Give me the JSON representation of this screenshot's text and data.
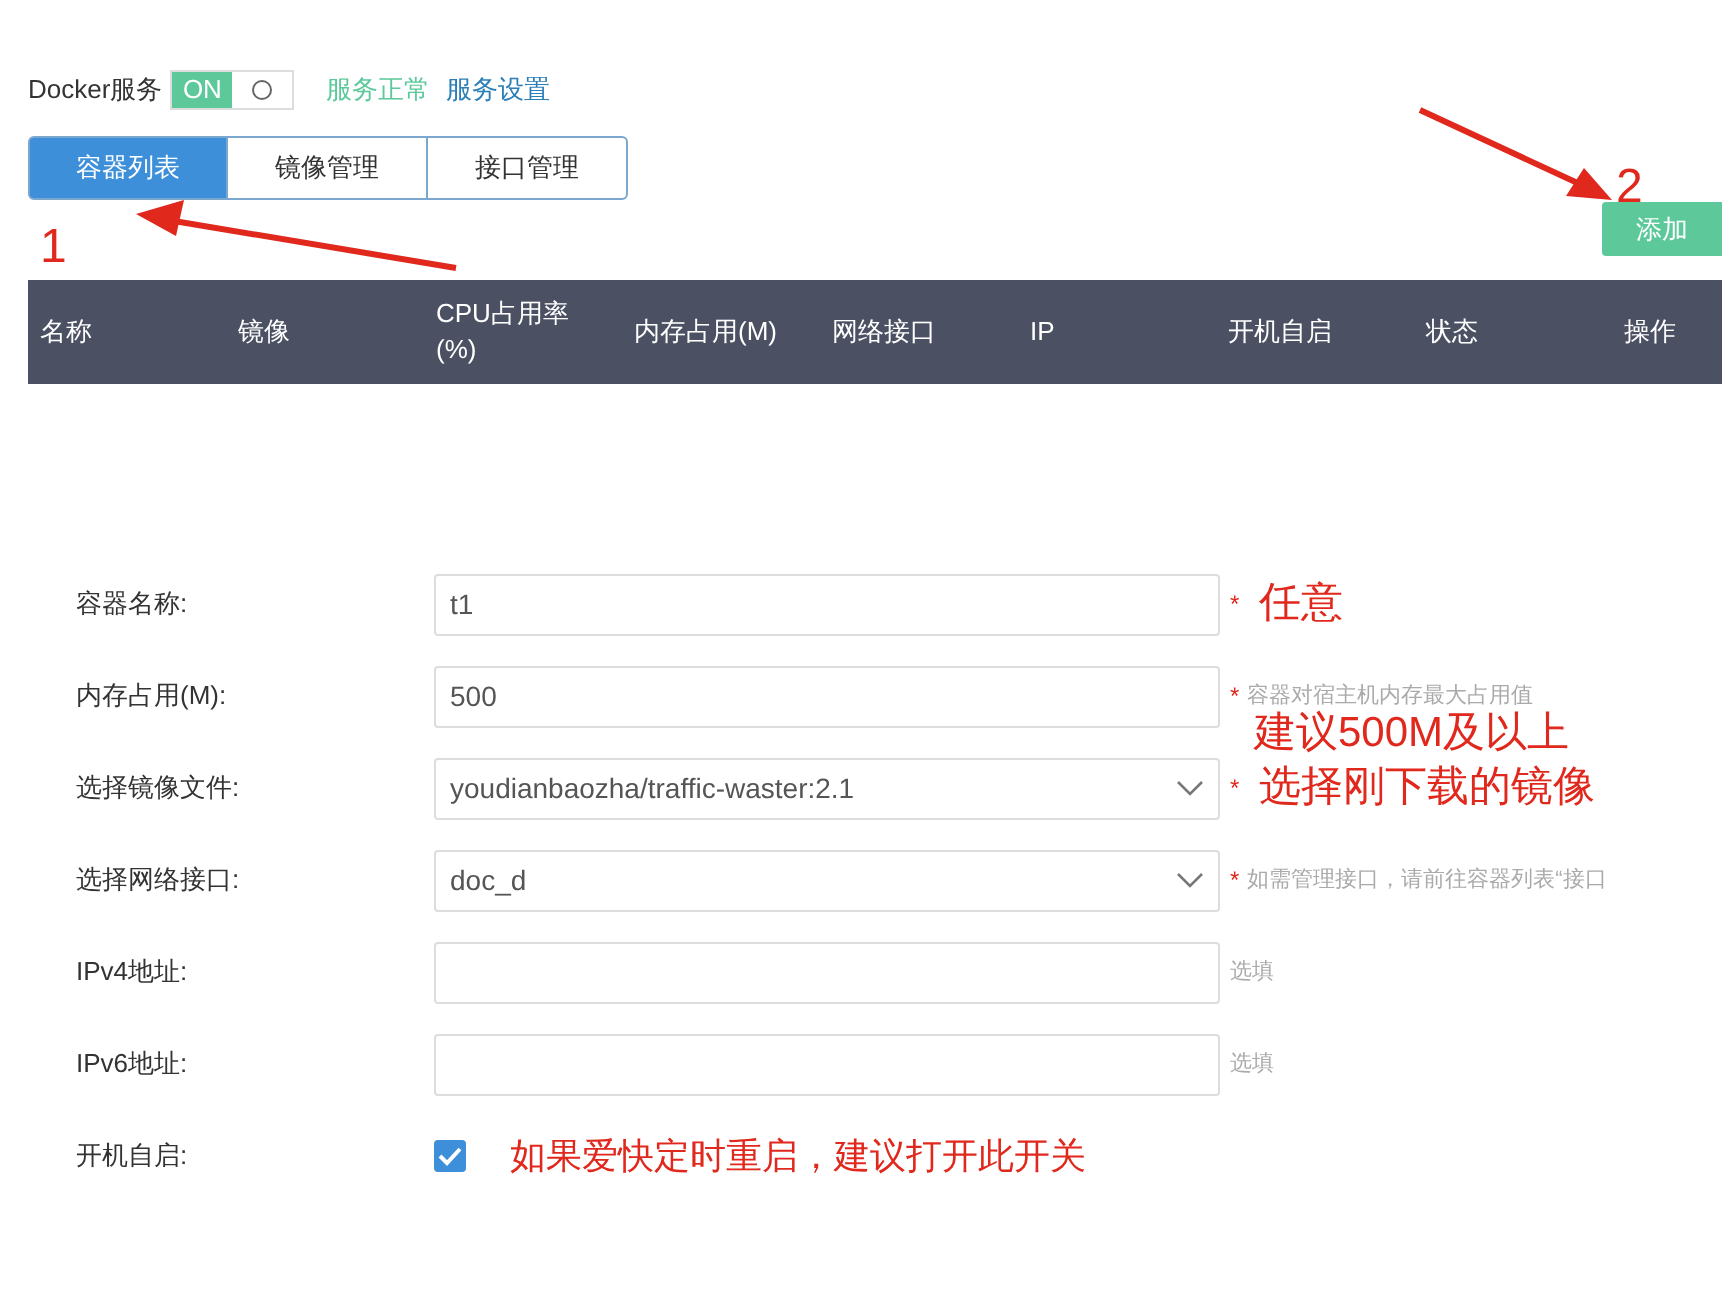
{
  "service": {
    "label": "Docker服务",
    "toggle": {
      "on": true,
      "label": "ON"
    },
    "status": "服务正常",
    "settings_link": "服务设置"
  },
  "tabs": [
    {
      "label": "容器列表",
      "selected": true
    },
    {
      "label": "镜像管理",
      "selected": false
    },
    {
      "label": "接口管理",
      "selected": false
    }
  ],
  "add_button": "添加",
  "table": {
    "columns": [
      "名称",
      "镜像",
      "CPU占用率 (%)",
      "内存占用(M)",
      "网络接口",
      "IP",
      "开机自启",
      "状态",
      "操作"
    ]
  },
  "form": {
    "fields": [
      {
        "kind": "text",
        "label": "容器名称:",
        "value": "t1",
        "required_mark": "*",
        "note": "任意"
      },
      {
        "kind": "text",
        "label": "内存占用(M):",
        "value": "500",
        "required_mark": "*",
        "hint": "容器对宿主机内存最大占用值",
        "note": "建议500M及以上"
      },
      {
        "kind": "select",
        "label": "选择镜像文件:",
        "value": "youdianbaozha/traffic-waster:2.1",
        "required_mark": "*",
        "note": "选择刚下载的镜像"
      },
      {
        "kind": "select",
        "label": "选择网络接口:",
        "value": "doc_d",
        "required_mark": "*",
        "hint": "如需管理接口，请前往容器列表“接口"
      },
      {
        "kind": "text",
        "label": "IPv4地址:",
        "hint": "选填"
      },
      {
        "kind": "text",
        "label": "IPv6地址:",
        "hint": "选填"
      },
      {
        "kind": "checkbox",
        "label": "开机自启:",
        "checked": true,
        "note": "如果爱快定时重启，建议打开此开关"
      }
    ]
  },
  "annotations": [
    {
      "label": "1"
    },
    {
      "label": "2"
    }
  ]
}
